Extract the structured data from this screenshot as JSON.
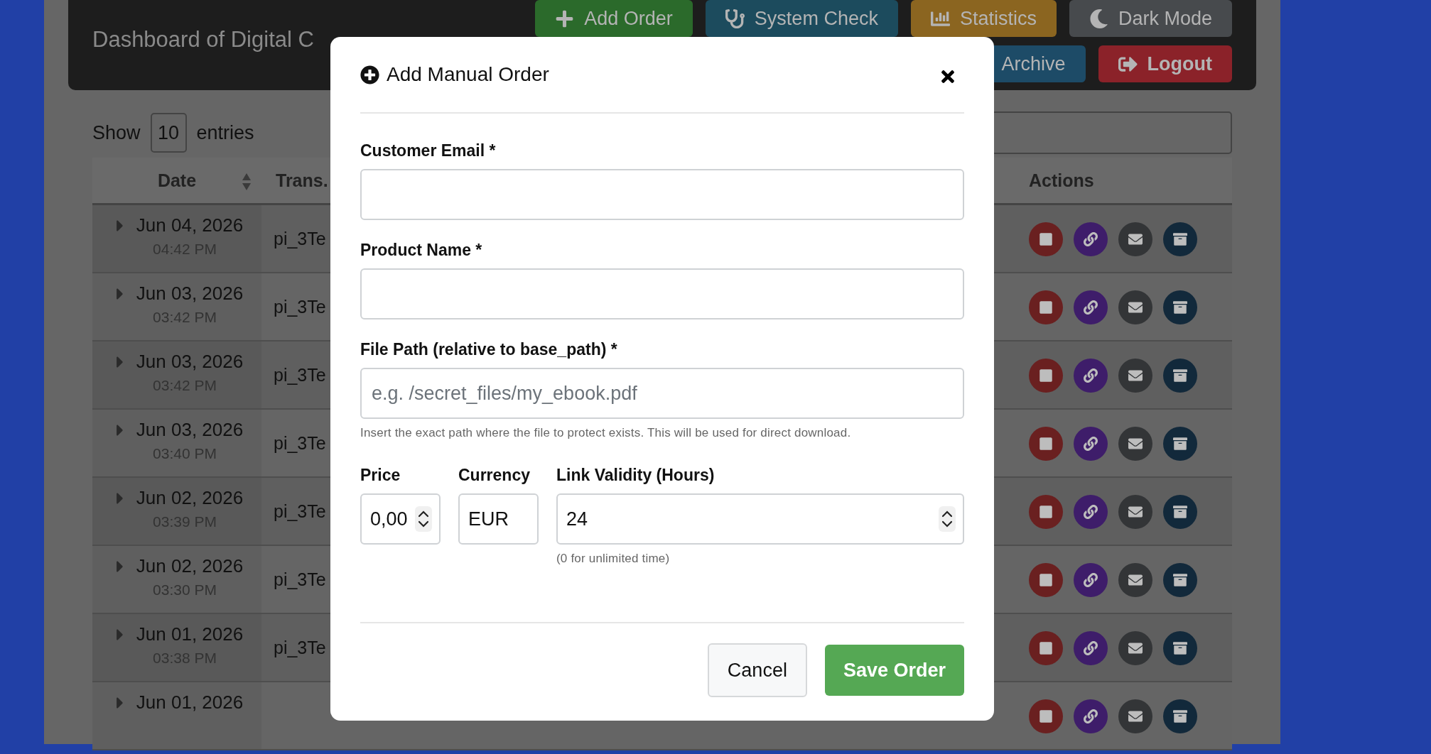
{
  "header": {
    "title": "Dashboard of Digital C",
    "buttons_top": [
      {
        "label": "Add Order",
        "kind": "add"
      },
      {
        "label": "System Check",
        "kind": "check"
      },
      {
        "label": "Statistics",
        "kind": "stats"
      },
      {
        "label": "Dark Mode",
        "kind": "dark"
      }
    ],
    "buttons_bottom": [
      {
        "label": "Archive",
        "kind": "archive"
      },
      {
        "label": "Logout",
        "kind": "logout"
      }
    ]
  },
  "table": {
    "length": {
      "before": "Show",
      "value": "10",
      "after": "entries"
    },
    "columns": [
      {
        "label": "Date",
        "sortable": true
      },
      {
        "label": "Trans.",
        "sortable": false
      },
      {
        "label": "Actions",
        "sortable": false
      }
    ],
    "rows": [
      {
        "date": "Jun 04, 2026",
        "time": "04:42 PM",
        "transaction": "pi_3Te"
      },
      {
        "date": "Jun 03, 2026",
        "time": "03:42 PM",
        "transaction": "pi_3Te"
      },
      {
        "date": "Jun 03, 2026",
        "time": "03:42 PM",
        "transaction": "pi_3Te"
      },
      {
        "date": "Jun 03, 2026",
        "time": "03:40 PM",
        "transaction": "pi_3Te"
      },
      {
        "date": "Jun 02, 2026",
        "time": "03:39 PM",
        "transaction": "pi_3Te"
      },
      {
        "date": "Jun 02, 2026",
        "time": "03:30 PM",
        "transaction": "pi_3Te"
      },
      {
        "date": "Jun 01, 2026",
        "time": "03:38 PM",
        "transaction": "pi_3Te"
      },
      {
        "date": "Jun 01, 2026"
      }
    ]
  },
  "modal": {
    "title": "Add Manual Order",
    "fields": [
      {
        "label": "Customer Email *"
      },
      {
        "label": "Product Name *"
      },
      {
        "label": "File Path (relative to base_path) *",
        "placeholder": "e.g. /secret_files/my_ebook.pdf",
        "help": "Insert the exact path where the file to protect exists. This will be used for direct download."
      }
    ],
    "row_fields": [
      {
        "label": "Price",
        "value": "0,00",
        "kind": "number"
      },
      {
        "label": "Currency",
        "value": "EUR",
        "kind": "text"
      },
      {
        "label": "Link Validity (Hours)",
        "value": "24",
        "kind": "number",
        "help": "(0 for unlimited time)"
      }
    ],
    "buttons": [
      {
        "label": "Cancel",
        "kind": "secondary"
      },
      {
        "label": "Save Order",
        "kind": "primary"
      }
    ]
  }
}
